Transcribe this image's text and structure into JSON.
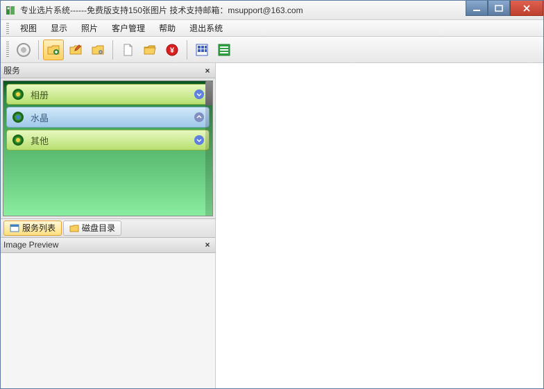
{
  "window": {
    "title": "专业选片系统------免费版支持150张图片      技术支持邮箱：msupport@163.com"
  },
  "menu": {
    "view": "视图",
    "display": "显示",
    "photo": "照片",
    "customer": "客户管理",
    "help": "帮助",
    "exit": "退出系统"
  },
  "panels": {
    "service_title": "服务",
    "preview_title": "Image Preview",
    "close_x": "×"
  },
  "service_rows": {
    "album": "相册",
    "crystal": "水晶",
    "other": "其他"
  },
  "tabs": {
    "service_list": "服务列表",
    "disk_dir": "磁盘目录"
  }
}
